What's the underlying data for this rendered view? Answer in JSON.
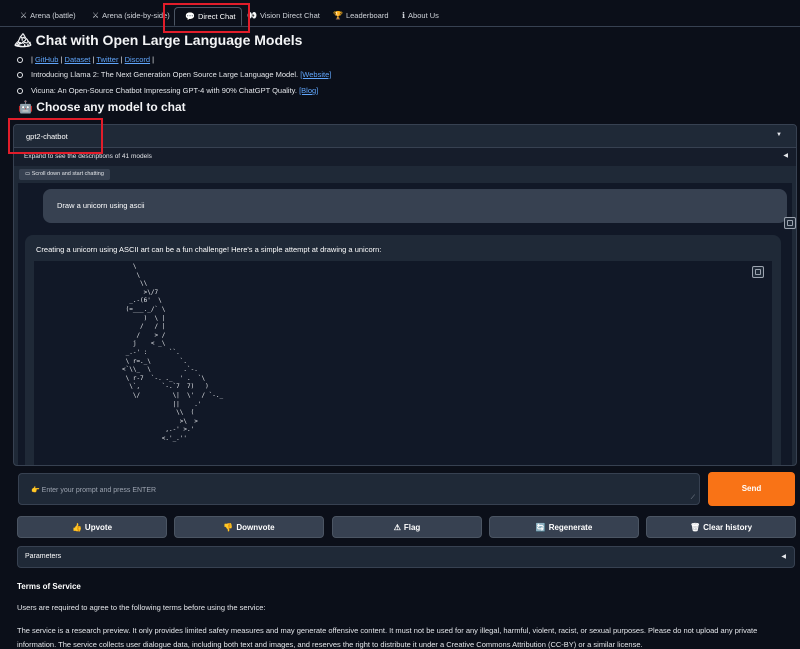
{
  "tabs": [
    {
      "icon": "⚔",
      "label": "Arena (battle)"
    },
    {
      "icon": "⚔",
      "label": "Arena (side-by-side)"
    },
    {
      "icon": "💬",
      "label": "Direct Chat"
    },
    {
      "icon": "👀",
      "label": "Vision Direct Chat"
    },
    {
      "icon": "🏆",
      "label": "Leaderboard"
    },
    {
      "icon": "ℹ",
      "label": "About Us"
    }
  ],
  "header": {
    "title_icon": "🏔",
    "title": "Chat with Open Large Language Models",
    "links": {
      "github": "GitHub",
      "dataset": "Dataset",
      "twitter": "Twitter",
      "discord": "Discord",
      "sep": "|"
    },
    "news1_text": "Introducing Llama 2: The Next Generation Open Source Large Language Model.",
    "news1_link": "[Website]",
    "news2_text": "Vicuna: An Open-Source Chatbot Impressing GPT-4 with 90% ChatGPT Quality.",
    "news2_link": "[Blog]",
    "subtitle_icon": "🤖",
    "subtitle": "Choose any model to chat"
  },
  "model_select": {
    "value": "gpt2-chatbot",
    "expand_label": "Expand to see the descriptions of 41 models"
  },
  "chat": {
    "label": "Scroll down and start chatting",
    "user_message": "Draw a unicorn using ascii",
    "bot_intro": "Creating a unicorn using ASCII art can be a fun challenge! Here's a simple attempt at drawing a unicorn:",
    "ascii": "   \\\n    \\\n     \\\\\n      >\\/7\n  _.-(6'  \\\n (=___._/` \\\n      )  \\ |\n     /   / |\n    /    > /\n   j    < _\\\n _.-' :      ``.\n \\ r=._\\        `.\n<`\\\\_  \\         .`-.\n \\ r-7  `-. ._  ' .  `\\\n  \\`,      `-.`7  7)   )\n   \\/         \\|  \\'  / `-._\n              ||    .'\n               \\\\  (\n                >\\  >\n            ,.-' >.'\n           <.'_.''"
  },
  "input": {
    "placeholder": "👉 Enter your prompt and press ENTER",
    "send_label": "Send"
  },
  "actions": [
    {
      "icon": "👍",
      "label": "Upvote"
    },
    {
      "icon": "👎",
      "label": "Downvote"
    },
    {
      "icon": "⚠",
      "label": "Flag"
    },
    {
      "icon": "🔄",
      "label": "Regenerate"
    },
    {
      "icon": "🗑",
      "label": "Clear history"
    }
  ],
  "parameters_label": "Parameters",
  "terms": {
    "heading": "Terms of Service",
    "p1": "Users are required to agree to the following terms before using the service:",
    "p2": "The service is a research preview. It only provides limited safety measures and may generate offensive content. It must not be used for any illegal, harmful, violent, racist, or sexual purposes. Please do not upload any private",
    "p3": "information. The service collects user dialogue data, including both text and images, and reserves the right to distribute it under a Creative Commons Attribution (CC-BY) or a similar license."
  },
  "colors": {
    "accent": "#f97316",
    "highlight_box": "#e11d2a",
    "link": "#60a5fa",
    "background": "#0b0f19"
  }
}
